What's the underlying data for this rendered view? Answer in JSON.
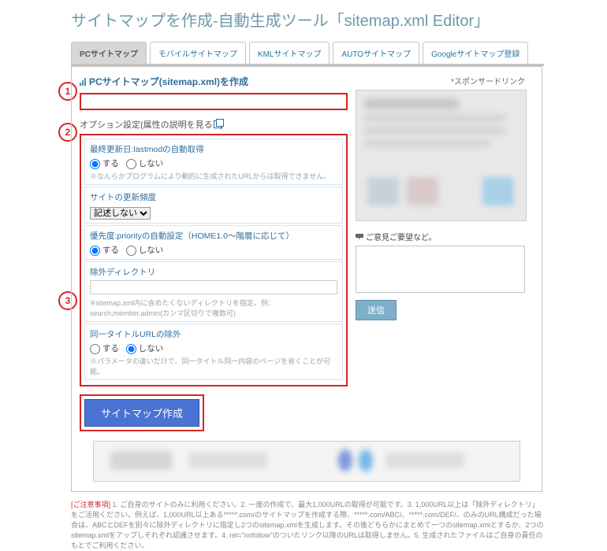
{
  "page_title": "サイトマップを作成-自動生成ツール「sitemap.xml Editor」",
  "tabs": [
    {
      "label": "PCサイトマップ",
      "active": true
    },
    {
      "label": "モバイルサイトマップ",
      "active": false
    },
    {
      "label": "KMLサイトマップ",
      "active": false
    },
    {
      "label": "AUTOサイトマップ",
      "active": false
    },
    {
      "label": "Googleサイトマップ登録",
      "active": false
    }
  ],
  "section": {
    "title": "PCサイトマップ(sitemap.xml)を作成"
  },
  "steps": {
    "one": "1",
    "two": "2",
    "three": "3"
  },
  "url_input": {
    "value": ""
  },
  "options_heading_pre": "オプション設定(属性の説明を見る",
  "options_heading_post": ")",
  "options": {
    "lastmod": {
      "title": "最終更新日:lastmodの自動取得",
      "yes": "する",
      "no": "しない",
      "selected": "yes",
      "note": "※なんらかプログラムにより動的に生成されたURLからは取得できません。"
    },
    "changefreq": {
      "title": "サイトの更新頻度",
      "selected": "記述しない",
      "choices": [
        "記述しない"
      ]
    },
    "priority": {
      "title": "優先度:priorityの自動設定（HOME1.0～階層に応じて）",
      "yes": "する",
      "no": "しない",
      "selected": "yes"
    },
    "exclude": {
      "title": "除外ディレクトリ",
      "value": "",
      "note": "※sitemap.xml内に含めたくないディレクトリを指定。例：search,member,admin(カンマ区切りで複数可)"
    },
    "sametitle": {
      "title": "同一タイトルURLの除外",
      "yes": "する",
      "no": "しない",
      "selected": "no",
      "note": "※パラメータの違いだけで、同一タイトル同一内容のページを省くことが可能。"
    }
  },
  "submit_label": "サイトマップ作成",
  "sidebar": {
    "sponsor": "*スポンサードリンク",
    "feedback_title": "ご意見ご要望など。",
    "send_label": "送信"
  },
  "disclaimer": {
    "warn": "[ご注意事項]",
    "body": " 1. ご自身のサイトのみに利用ください。2. 一度の作成で、最大1,000URLの取得が可能です。3. 1,000URL以上は「除外ディレクトリ」をご活用ください。例えば、1,000URL以上ある*****.com/のサイトマップを作成する際、*****.com/ABC/、*****.com/DEF/、のみのURL構成だった場合は、ABCとDEFを別々に除外ディレクトリに指定し2つのsitemap.xmlを生成します。その後どちらかにまとめて一つのsitemap.xmlとするか、2つのsitemap.xmlをアップしそれぞれ認識させます。4. rel=\"nofollow\"のついたリンク以降のURLは取得しません。5. 生成されたファイルはご自身の責任のもとでご利用ください。"
  }
}
